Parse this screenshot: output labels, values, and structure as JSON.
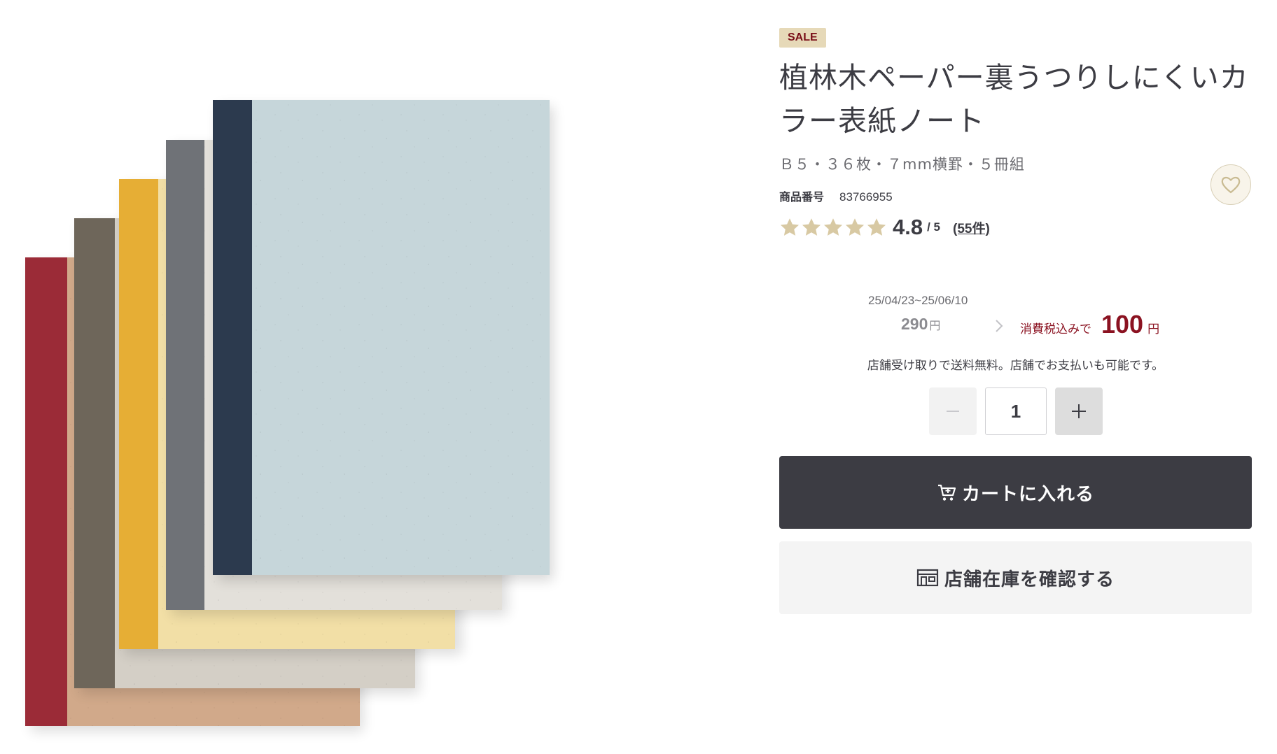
{
  "badge": {
    "label": "SALE"
  },
  "product": {
    "title": "植林木ペーパー裏うつりしにくいカラー表紙ノート",
    "spec": "Ｂ５・３６枚・７mm横罫・５冊組",
    "sku_label": "商品番号",
    "sku_value": "83766955",
    "image_alt": "Five stacked colored-cover notebooks"
  },
  "rating": {
    "stars": 5,
    "value": "4.8",
    "max": "/ 5",
    "count": "(55件)"
  },
  "pricing": {
    "period": "25/04/23~25/06/10",
    "old_price": "290",
    "currency": "円",
    "tax_label": "消費税込みで",
    "new_price": "100"
  },
  "pickup_note": "店舗受け取りで送料無料。店舗でお支払いも可能です。",
  "quantity": {
    "value": "1"
  },
  "actions": {
    "add_to_cart": "カートに入れる",
    "check_stock": "店舗在庫を確認する"
  },
  "icons": {
    "favorite": "heart-icon",
    "cart": "cart-add-icon",
    "store": "store-icon",
    "minus": "minus-icon",
    "plus": "plus-icon",
    "arrow": "chevron-right-icon",
    "star": "star-icon"
  },
  "colors": {
    "accent_red": "#8b1221",
    "dark_button": "#3c3c43",
    "star": "#d8c9a3",
    "badge_bg": "#e6d9b8",
    "notebooks": [
      "#9b2b37",
      "#6e665a",
      "#e6ae35",
      "#6f7277",
      "#2c3a4e"
    ]
  }
}
